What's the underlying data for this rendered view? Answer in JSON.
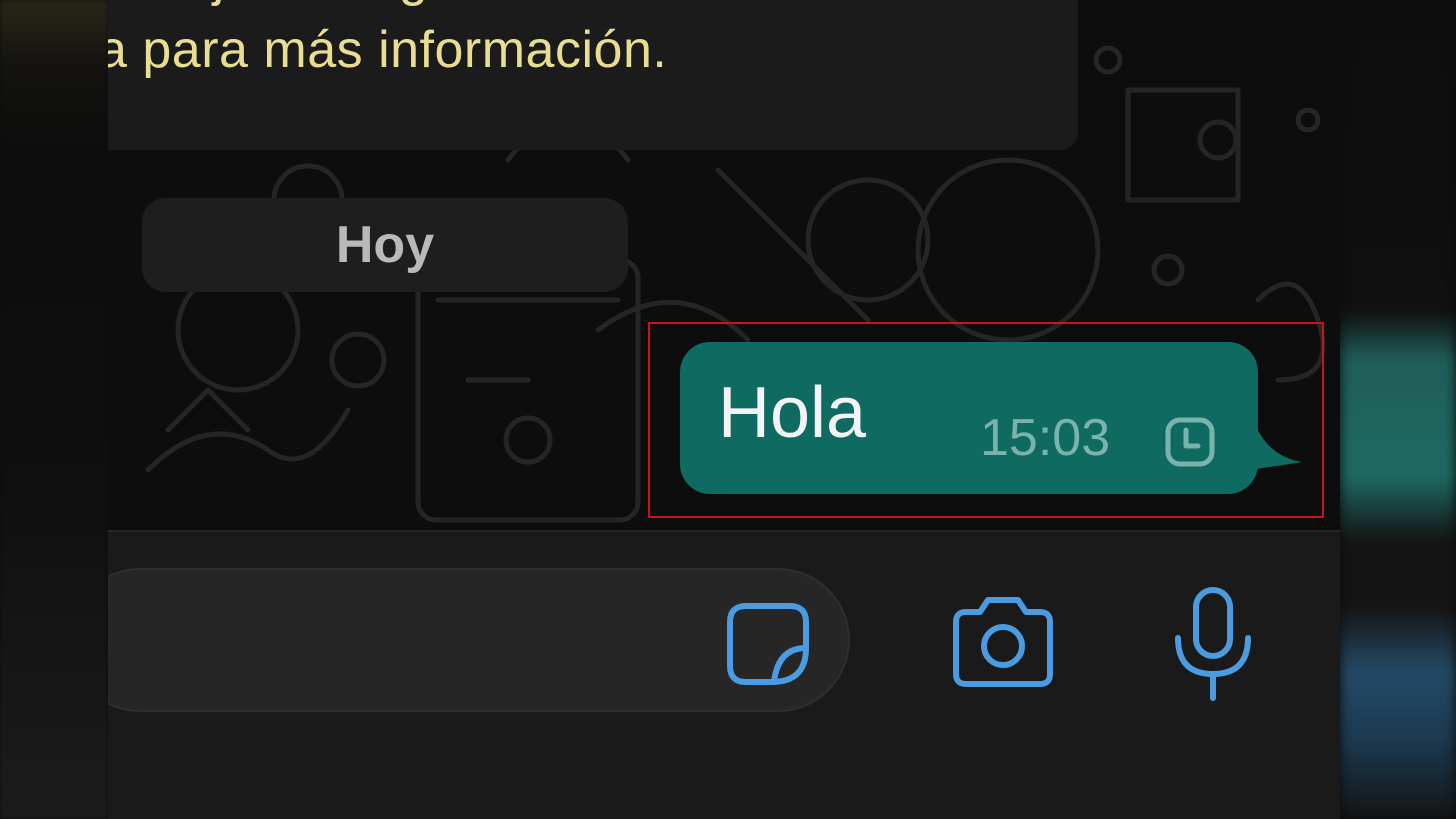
{
  "banner": {
    "line1": "ensaje de seguridad con Bille.",
    "line2": "a para más información."
  },
  "chat": {
    "date_divider": "Hoy",
    "messages": [
      {
        "text": "Hola",
        "time": "15:03",
        "status_icon": "clock-icon",
        "direction": "outgoing"
      }
    ]
  },
  "composer": {
    "icons": [
      "sticker-icon",
      "camera-icon",
      "microphone-icon"
    ]
  },
  "colors": {
    "outgoing_bubble": "#0f6a62",
    "accent_icon": "#4a9be0",
    "banner_text": "#e9dd94",
    "highlight_box": "#c8141e"
  }
}
